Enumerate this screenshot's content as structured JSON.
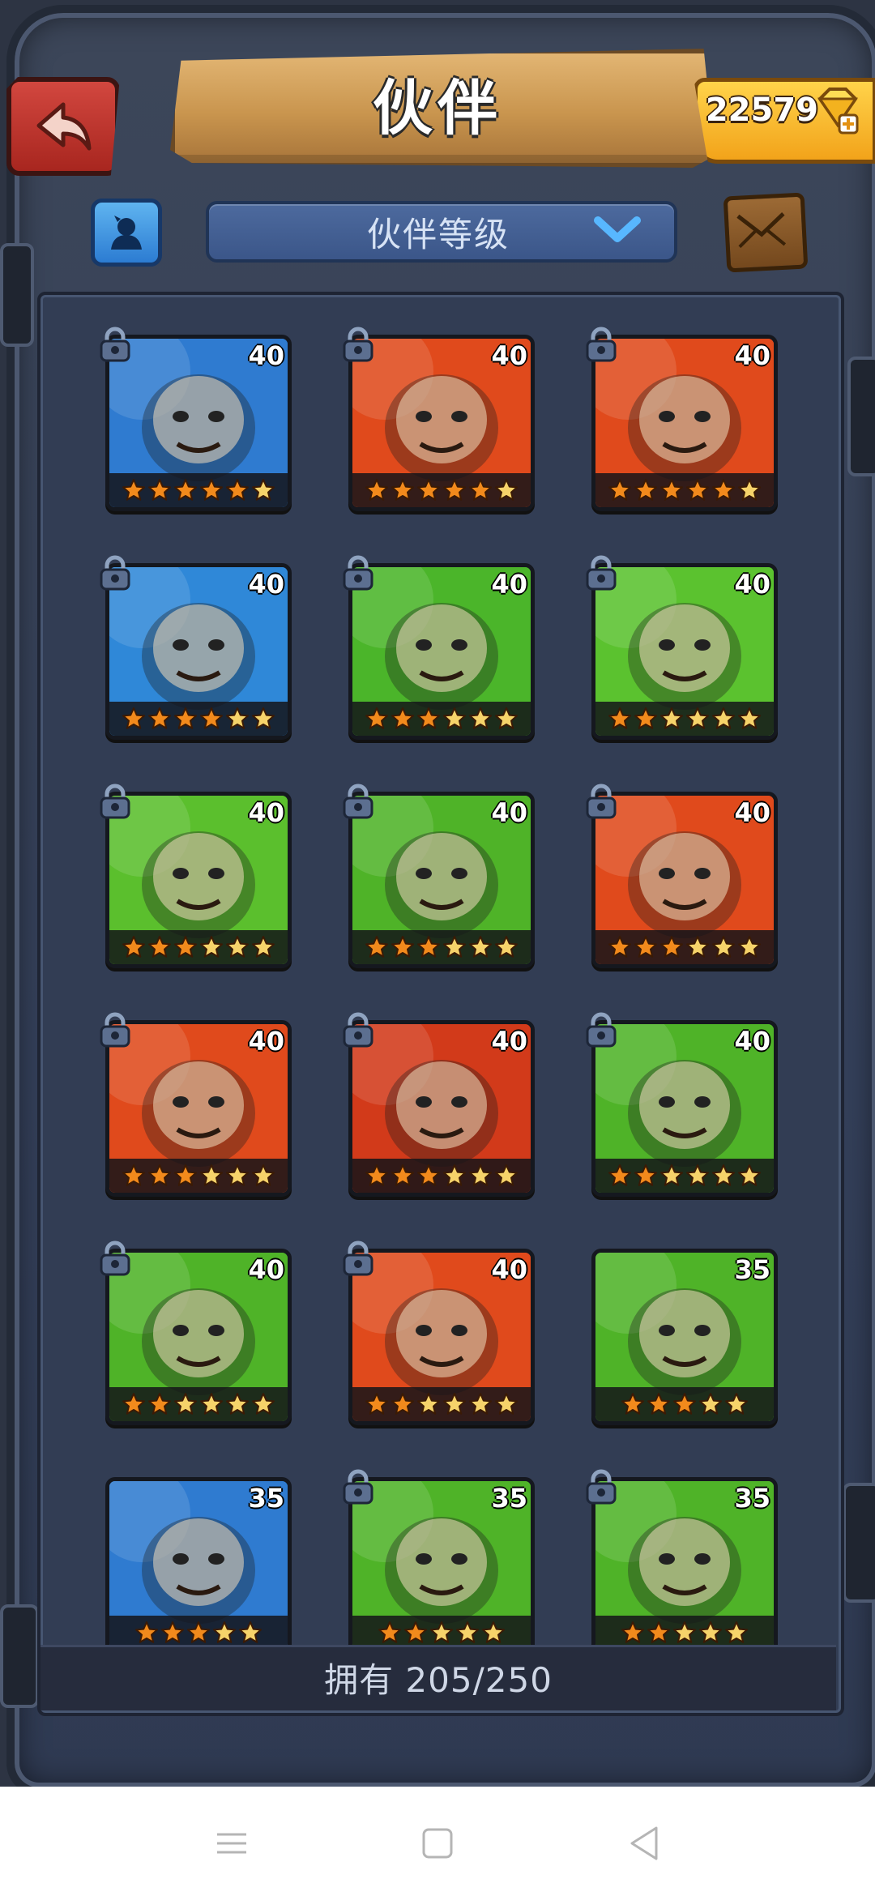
{
  "header": {
    "title": "伙伴",
    "gold": "22579"
  },
  "filter": {
    "sort_label": "伙伴等级"
  },
  "footer": {
    "owned": "拥有 205/250"
  },
  "colors": {
    "star_filled": "#f28a1c",
    "star_gold": "#f6d36a",
    "accent_blue": "#3b5689"
  },
  "partners": [
    {
      "level": "40",
      "stars": 6,
      "filled": 5,
      "bg": "#2f7bd0",
      "locked": true
    },
    {
      "level": "40",
      "stars": 6,
      "filled": 5,
      "bg": "#e04a1c",
      "locked": true
    },
    {
      "level": "40",
      "stars": 6,
      "filled": 5,
      "bg": "#e04a1c",
      "locked": true
    },
    {
      "level": "40",
      "stars": 6,
      "filled": 4,
      "bg": "#2f88d8",
      "locked": true
    },
    {
      "level": "40",
      "stars": 6,
      "filled": 3,
      "bg": "#4bb52a",
      "locked": true
    },
    {
      "level": "40",
      "stars": 6,
      "filled": 2,
      "bg": "#5bc22f",
      "locked": true
    },
    {
      "level": "40",
      "stars": 6,
      "filled": 3,
      "bg": "#5bbf2d",
      "locked": true
    },
    {
      "level": "40",
      "stars": 6,
      "filled": 3,
      "bg": "#4fb328",
      "locked": true
    },
    {
      "level": "40",
      "stars": 6,
      "filled": 3,
      "bg": "#e04a1c",
      "locked": true
    },
    {
      "level": "40",
      "stars": 6,
      "filled": 3,
      "bg": "#e04a1c",
      "locked": true
    },
    {
      "level": "40",
      "stars": 6,
      "filled": 3,
      "bg": "#d23a1a",
      "locked": true
    },
    {
      "level": "40",
      "stars": 6,
      "filled": 2,
      "bg": "#4fb328",
      "locked": true
    },
    {
      "level": "40",
      "stars": 6,
      "filled": 2,
      "bg": "#4fb328",
      "locked": true
    },
    {
      "level": "40",
      "stars": 6,
      "filled": 2,
      "bg": "#e04a1c",
      "locked": true
    },
    {
      "level": "35",
      "stars": 5,
      "filled": 3,
      "bg": "#4fb328",
      "locked": false
    },
    {
      "level": "35",
      "stars": 5,
      "filled": 3,
      "bg": "#2f7bd0",
      "locked": false
    },
    {
      "level": "35",
      "stars": 5,
      "filled": 2,
      "bg": "#4fb328",
      "locked": true
    },
    {
      "level": "35",
      "stars": 5,
      "filled": 2,
      "bg": "#4fb328",
      "locked": true
    }
  ]
}
